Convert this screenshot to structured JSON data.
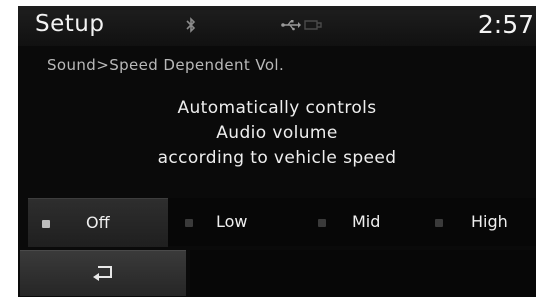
{
  "header": {
    "title": "Setup",
    "clock": "2:57",
    "icons": [
      "bluetooth-icon",
      "usb-icon",
      "ipod-icon"
    ]
  },
  "breadcrumb": "Sound>Speed Dependent Vol.",
  "description": {
    "lines": [
      "Automatically controls",
      "Audio volume",
      "according to vehicle speed"
    ]
  },
  "options": {
    "selected": "Off",
    "items": [
      {
        "label": "Off"
      },
      {
        "label": "Low"
      },
      {
        "label": "Mid"
      },
      {
        "label": "High"
      }
    ]
  },
  "back": {
    "icon": "back-arrow-icon"
  },
  "colors": {
    "background": "#0a0a0a",
    "text": "#f2f2f2",
    "breadcrumb": "#b9b9b9",
    "selected_bg": "#2a2a2a",
    "button_bg": "#303030"
  }
}
